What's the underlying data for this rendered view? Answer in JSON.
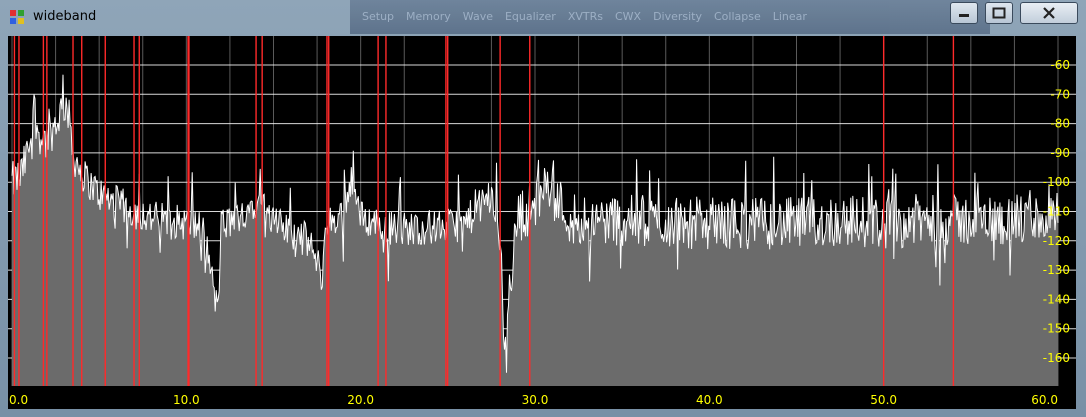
{
  "window": {
    "title": "wideband"
  },
  "background_menu": [
    "Setup",
    "Memory",
    "Wave",
    "Equalizer",
    "XVTRs",
    "CWX",
    "Diversity",
    "Collapse",
    "Linear"
  ],
  "icons": {
    "app": "app-icon",
    "minimize": "minimize-icon",
    "maximize": "maximize-icon",
    "close": "close-icon"
  },
  "colors": {
    "background": "#000000",
    "grid": "#ffffff",
    "marker": "#ff2a2a",
    "label": "#ffff00",
    "spectrum_fill": "#6b6b6b",
    "spectrum_line": "#ffffff"
  },
  "chart_data": {
    "type": "area",
    "title": "",
    "xlabel": "",
    "ylabel": "",
    "xlim": [
      0,
      60
    ],
    "ylim": [
      -165,
      -50
    ],
    "x_ticks": [
      "0.0",
      "10.0",
      "20.0",
      "30.0",
      "40.0",
      "50.0",
      "60.0"
    ],
    "y_ticks": [
      "-60",
      "-70",
      "-80",
      "-90",
      "-100",
      "-110",
      "-120",
      "-130",
      "-140",
      "-150",
      "-160"
    ],
    "markers_mhz": [
      0.14,
      0.4,
      1.8,
      2.0,
      3.5,
      4.0,
      5.35,
      7.0,
      7.3,
      10.1,
      10.15,
      14.0,
      14.35,
      18.068,
      18.168,
      21.0,
      21.45,
      24.89,
      24.99,
      28.0,
      29.7,
      50.0,
      54.0
    ],
    "spectrum": {
      "x": [
        0,
        0.5,
        1.0,
        1.2,
        1.5,
        2.0,
        2.5,
        3.0,
        3.2,
        3.5,
        4.0,
        5.0,
        6.0,
        7.0,
        8.0,
        10.0,
        11.0,
        11.8,
        12.0,
        13.0,
        14.0,
        14.2,
        14.5,
        15.0,
        17.0,
        17.8,
        18.0,
        19.0,
        19.5,
        20.0,
        22.0,
        25.0,
        26.0,
        27.5,
        28.0,
        28.2,
        29.0,
        30.0,
        30.5,
        32.0,
        35.0,
        40.0,
        45.0,
        48.0,
        50.0,
        52.0,
        55.0,
        58.0,
        60.0
      ],
      "y": [
        -100,
        -98,
        -88,
        -72,
        -83,
        -86,
        -80,
        -73,
        -75,
        -90,
        -97,
        -104,
        -107,
        -110,
        -112,
        -114,
        -116,
        -145,
        -115,
        -112,
        -106,
        -98,
        -110,
        -114,
        -120,
        -132,
        -115,
        -110,
        -98,
        -112,
        -116,
        -115,
        -114,
        -104,
        -120,
        -153,
        -112,
        -108,
        -100,
        -112,
        -113,
        -114,
        -114,
        -113,
        -114,
        -113,
        -113,
        -113,
        -112
      ]
    }
  }
}
